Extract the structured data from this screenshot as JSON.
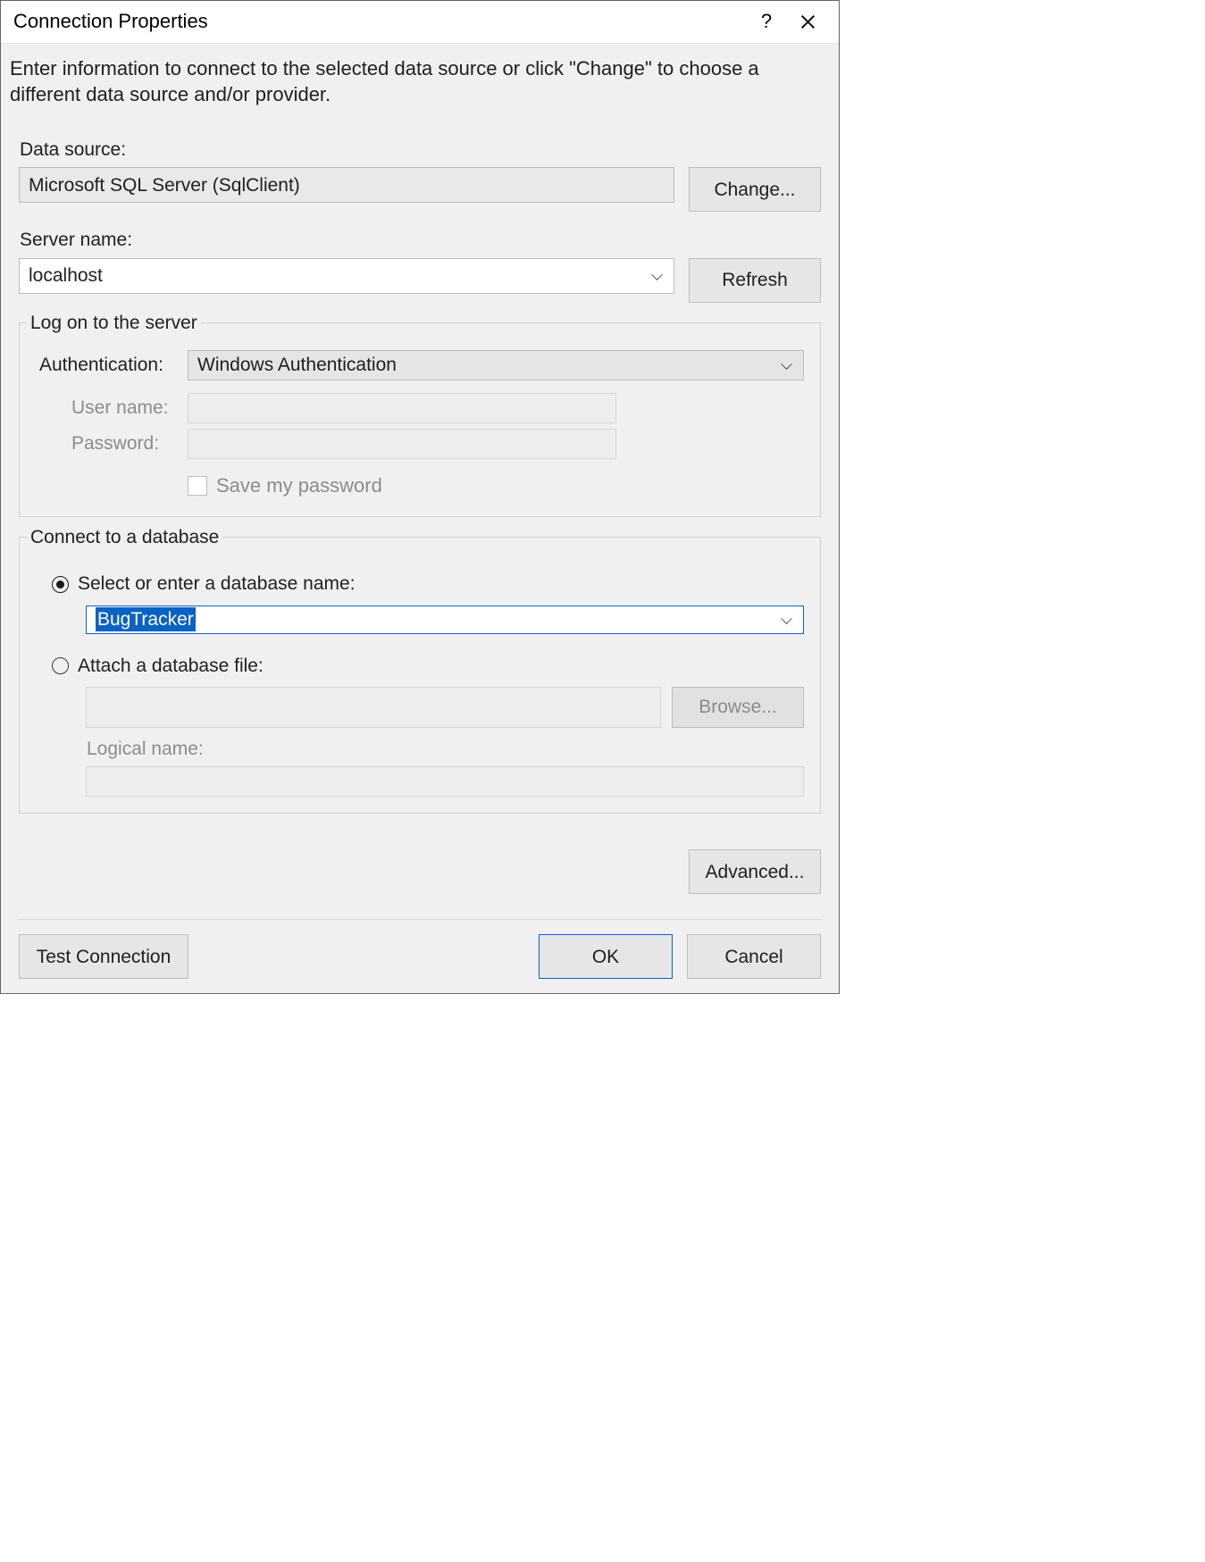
{
  "window": {
    "title": "Connection Properties"
  },
  "instruction": "Enter information to connect to the selected data source or click \"Change\" to choose a different data source and/or provider.",
  "dataSource": {
    "label": "Data source:",
    "value": "Microsoft SQL Server (SqlClient)",
    "changeButton": "Change..."
  },
  "server": {
    "label": "Server name:",
    "value": "localhost",
    "refreshButton": "Refresh"
  },
  "logon": {
    "groupTitle": "Log on to the server",
    "authLabel": "Authentication:",
    "authValue": "Windows Authentication",
    "userLabel": "User name:",
    "userValue": "",
    "passLabel": "Password:",
    "passValue": "",
    "savePwdLabel": "Save my password",
    "savePwdChecked": false
  },
  "db": {
    "groupTitle": "Connect to a database",
    "radioSelectLabel": "Select or enter a database name:",
    "selectedDbName": "BugTracker",
    "radioAttachLabel": "Attach a database file:",
    "attachPath": "",
    "browseButton": "Browse...",
    "logicalLabel": "Logical name:",
    "logicalValue": ""
  },
  "advancedButton": "Advanced...",
  "footer": {
    "testButton": "Test Connection",
    "okButton": "OK",
    "cancelButton": "Cancel"
  }
}
